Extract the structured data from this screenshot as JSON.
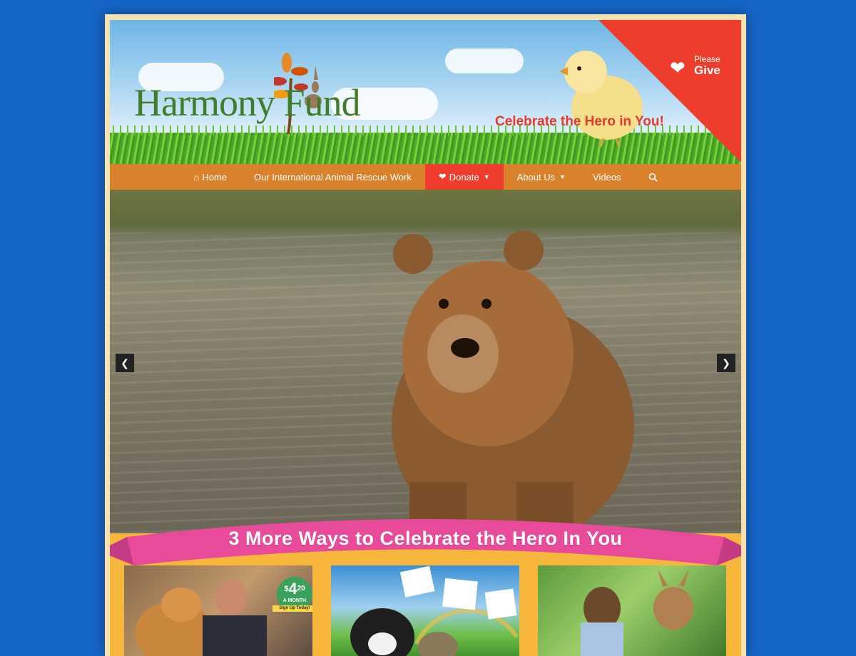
{
  "brand": {
    "name": "Harmony Fund",
    "tagline": "Celebrate the Hero in You!"
  },
  "give": {
    "please": "Please",
    "give": "Give"
  },
  "nav": {
    "items": [
      {
        "label": "Home",
        "icon": "home-icon"
      },
      {
        "label": "Our International Animal Rescue Work"
      },
      {
        "label": "Donate",
        "icon": "heart-icon",
        "active": true
      },
      {
        "label": "About Us"
      },
      {
        "label": "Videos"
      }
    ],
    "search_icon": "search-icon"
  },
  "hero": {
    "prev_icon": "chevron-left-icon",
    "next_icon": "chevron-right-icon"
  },
  "banner": {
    "text": "3 More Ways to Celebrate the Hero In You"
  },
  "cards": {
    "card1": {
      "price_dollar": "$",
      "price_num": "4",
      "price_cents": "20",
      "price_sub": "A MONTH",
      "price_cta": "Sign Up Today!"
    }
  },
  "colors": {
    "accent": "#ee3d2d",
    "nav": "#d9822b",
    "banner": "#e84b9a",
    "background": "#1565c7"
  }
}
